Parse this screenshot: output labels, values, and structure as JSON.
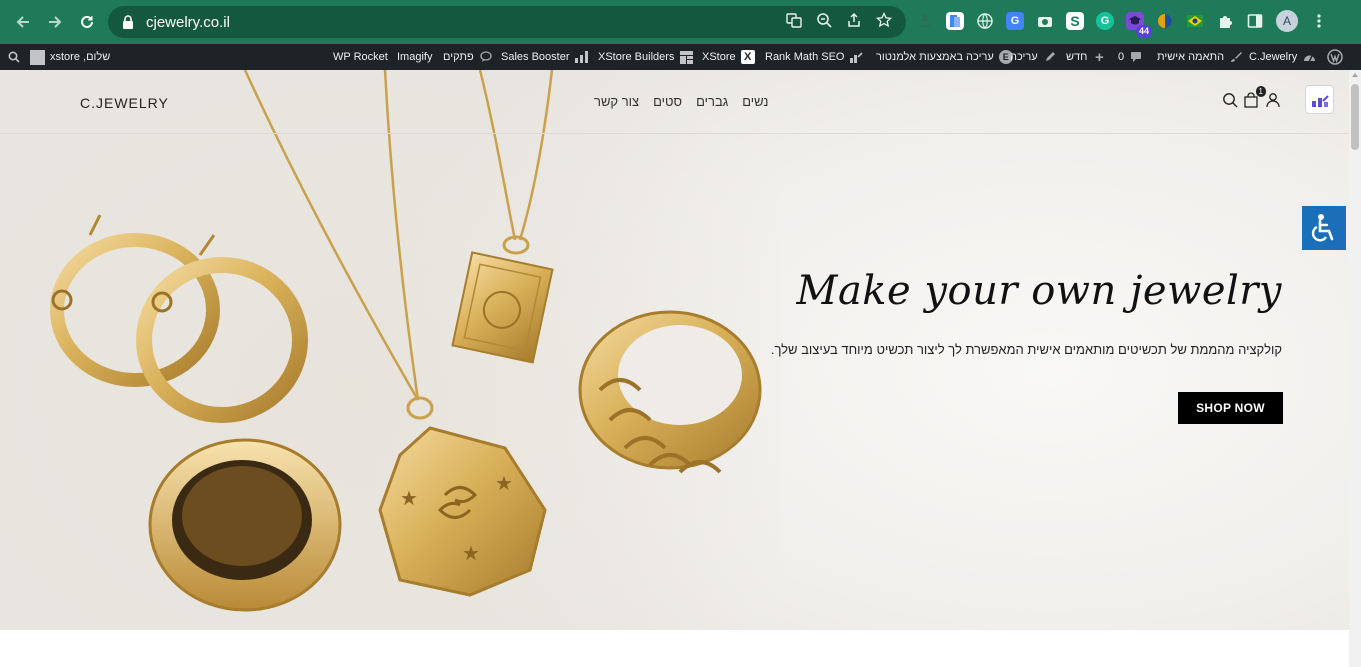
{
  "browser": {
    "url": "cjewelry.co.il",
    "extension_badge": "44",
    "profile_initial": "A"
  },
  "admin_bar": {
    "site_name": "C.Jewelry",
    "customize": "התאמה אישית",
    "comments_count": "0",
    "new": "חדש",
    "edit": "עריכה",
    "elementor_edit": "עריכה באמצעות אלמנטור",
    "rank_math": "Rank Math SEO",
    "xstore": "XStore",
    "xstore_builders": "XStore Builders",
    "sales_booster": "Sales Booster",
    "snippets": "פתקים",
    "imagify": "Imagify",
    "wp_rocket": "WP Rocket",
    "greeting": "שלום, xstore"
  },
  "site": {
    "logo": "C.JEWELRY",
    "menu": [
      "נשים",
      "גברים",
      "סטים",
      "צור קשר"
    ],
    "cart_count": "1"
  },
  "hero": {
    "title": "Make your own jewelry",
    "subtitle": "קולקציה מהממת של תכשיטים מותאמים אישית המאפשרת לך ליצור תכשיט מיוחד בעיצוב שלך.",
    "cta": "SHOP NOW"
  },
  "colors": {
    "chrome": "#1f7a5a",
    "adminbar": "#1d2327",
    "gold": "#d9b15a",
    "accessibility": "#1a6fb8"
  }
}
